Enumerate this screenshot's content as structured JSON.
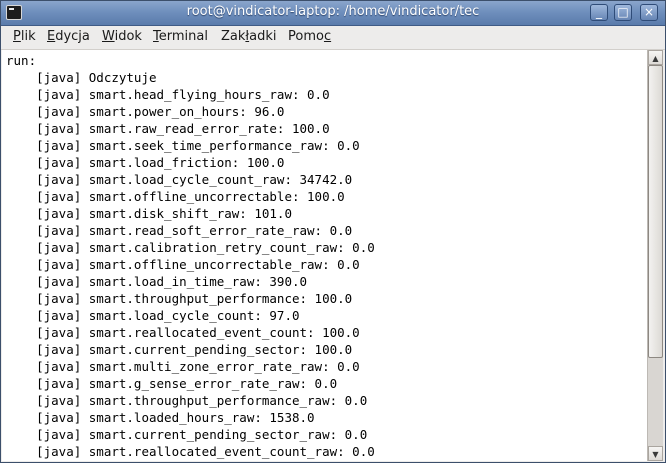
{
  "window": {
    "title": "root@vindicator-laptop: /home/vindicator/tec",
    "buttons": {
      "minimize": "_",
      "maximize": "□",
      "close": "×"
    }
  },
  "menubar": {
    "items": [
      {
        "accel": "P",
        "rest": "lik"
      },
      {
        "accel": "E",
        "rest": "dycja"
      },
      {
        "accel": "W",
        "rest": "idok"
      },
      {
        "accel": "T",
        "rest": "erminal"
      },
      {
        "pre": "Zak",
        "accel": "ł",
        "rest": "adki"
      },
      {
        "pre": "Pomo",
        "accel": "c",
        "rest": ""
      }
    ]
  },
  "terminal": {
    "lines": [
      "run:",
      "    [java] Odczytuje",
      "    [java] smart.head_flying_hours_raw: 0.0",
      "    [java] smart.power_on_hours: 96.0",
      "    [java] smart.raw_read_error_rate: 100.0",
      "    [java] smart.seek_time_performance_raw: 0.0",
      "    [java] smart.load_friction: 100.0",
      "    [java] smart.load_cycle_count_raw: 34742.0",
      "    [java] smart.offline_uncorrectable: 100.0",
      "    [java] smart.disk_shift_raw: 101.0",
      "    [java] smart.read_soft_error_rate_raw: 0.0",
      "    [java] smart.calibration_retry_count_raw: 0.0",
      "    [java] smart.offline_uncorrectable_raw: 0.0",
      "    [java] smart.load_in_time_raw: 390.0",
      "    [java] smart.throughput_performance: 100.0",
      "    [java] smart.load_cycle_count: 97.0",
      "    [java] smart.reallocated_event_count: 100.0",
      "    [java] smart.current_pending_sector: 100.0",
      "    [java] smart.multi_zone_error_rate_raw: 0.0",
      "    [java] smart.g_sense_error_rate_raw: 0.0",
      "    [java] smart.throughput_performance_raw: 0.0",
      "    [java] smart.loaded_hours_raw: 1538.0",
      "    [java] smart.current_pending_sector_raw: 0.0",
      "    [java] smart.reallocated_event_count_raw: 0.0"
    ]
  },
  "scrollbar": {
    "up_arrow": "▲",
    "down_arrow": "▼",
    "visible_fraction": 0.77,
    "scroll_position": 0.0
  }
}
